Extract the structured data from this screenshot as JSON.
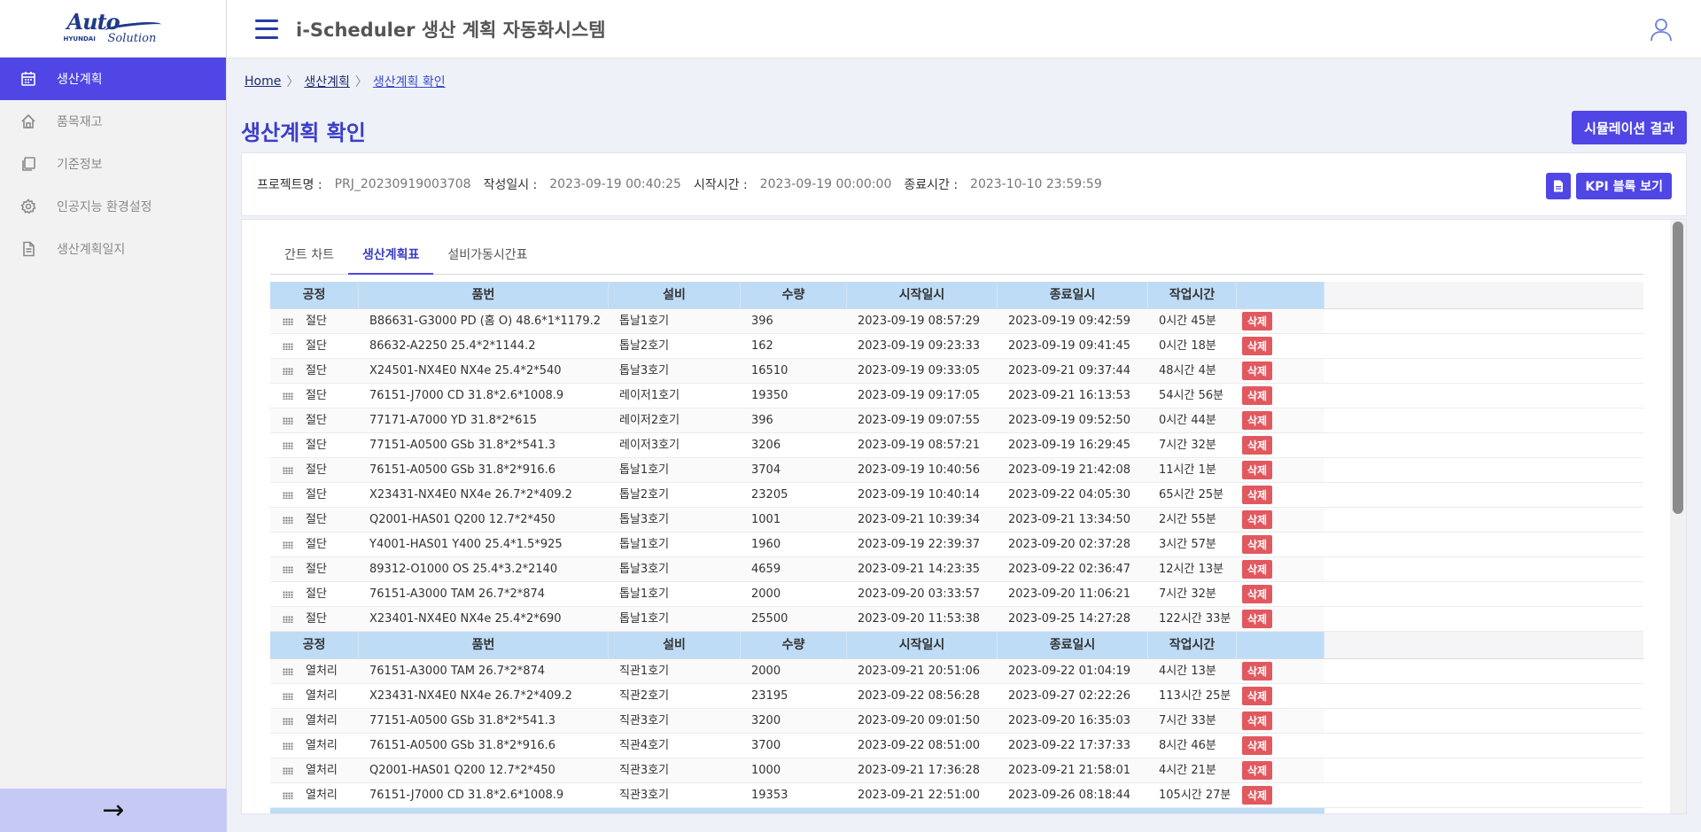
{
  "logo": {
    "auto": "Auto",
    "hyundai": "HYUNDAI",
    "solution": "Solution"
  },
  "app_title": "i-Scheduler 생산 계획 자동화시스템",
  "sidebar": {
    "items": [
      {
        "label": "생산계획",
        "icon": "calendar-icon"
      },
      {
        "label": "품목재고",
        "icon": "home-icon"
      },
      {
        "label": "기준정보",
        "icon": "copy-icon"
      },
      {
        "label": "인공지능 환경설정",
        "icon": "gear-icon"
      },
      {
        "label": "생산계획일지",
        "icon": "document-icon"
      }
    ],
    "toggle": "→"
  },
  "breadcrumb": {
    "home": "Home",
    "level1": "생산계획",
    "current": "생산계획 확인",
    "sep": "〉"
  },
  "page_title": "생산계획 확인",
  "simulation_button": "시뮬레이션 결과",
  "info": {
    "project_label": "프로젝트명 :",
    "project_value": "PRJ_20230919003708",
    "created_label": "작성일시 :",
    "created_value": "2023-09-19 00:40:25",
    "start_label": "시작시간 :",
    "start_value": "2023-09-19 00:00:00",
    "end_label": "종료시간 :",
    "end_value": "2023-10-10 23:59:59",
    "kpi_button": "KPI 블록 보기"
  },
  "tabs": [
    "간트 차트",
    "생산계획표",
    "설비가동시간표"
  ],
  "columns": [
    "공정",
    "품번",
    "설비",
    "수량",
    "시작일시",
    "종료일시",
    "작업시간"
  ],
  "delete_label": "삭제",
  "groups": [
    {
      "rows": [
        [
          "절단",
          "B86631-G3000 PD (홈 O) 48.6*1*1179.2",
          "톱날1호기",
          "396",
          "2023-09-19 08:57:29",
          "2023-09-19 09:42:59",
          "0시간 45분"
        ],
        [
          "절단",
          "86632-A2250 25.4*2*1144.2",
          "톱날2호기",
          "162",
          "2023-09-19 09:23:33",
          "2023-09-19 09:41:45",
          "0시간 18분"
        ],
        [
          "절단",
          "X24501-NX4E0 NX4e 25.4*2*540",
          "톱날3호기",
          "16510",
          "2023-09-19 09:33:05",
          "2023-09-21 09:37:44",
          "48시간 4분"
        ],
        [
          "절단",
          "76151-J7000 CD 31.8*2.6*1008.9",
          "레이저1호기",
          "19350",
          "2023-09-19 09:17:05",
          "2023-09-21 16:13:53",
          "54시간 56분"
        ],
        [
          "절단",
          "77171-A7000 YD 31.8*2*615",
          "레이저2호기",
          "396",
          "2023-09-19 09:07:55",
          "2023-09-19 09:52:50",
          "0시간 44분"
        ],
        [
          "절단",
          "77151-A0500 GSb 31.8*2*541.3",
          "레이저3호기",
          "3206",
          "2023-09-19 08:57:21",
          "2023-09-19 16:29:45",
          "7시간 32분"
        ],
        [
          "절단",
          "76151-A0500 GSb 31.8*2*916.6",
          "톱날1호기",
          "3704",
          "2023-09-19 10:40:56",
          "2023-09-19 21:42:08",
          "11시간 1분"
        ],
        [
          "절단",
          "X23431-NX4E0 NX4e 26.7*2*409.2",
          "톱날2호기",
          "23205",
          "2023-09-19 10:40:14",
          "2023-09-22 04:05:30",
          "65시간 25분"
        ],
        [
          "절단",
          "Q2001-HAS01 Q200 12.7*2*450",
          "톱날3호기",
          "1001",
          "2023-09-21 10:39:34",
          "2023-09-21 13:34:50",
          "2시간 55분"
        ],
        [
          "절단",
          "Y4001-HAS01 Y400 25.4*1.5*925",
          "톱날1호기",
          "1960",
          "2023-09-19 22:39:37",
          "2023-09-20 02:37:28",
          "3시간 57분"
        ],
        [
          "절단",
          "89312-O1000 OS 25.4*3.2*2140",
          "톱날3호기",
          "4659",
          "2023-09-21 14:23:35",
          "2023-09-22 02:36:47",
          "12시간 13분"
        ],
        [
          "절단",
          "76151-A3000 TAM 26.7*2*874",
          "톱날1호기",
          "2000",
          "2023-09-20 03:33:57",
          "2023-09-20 11:06:21",
          "7시간 32분"
        ],
        [
          "절단",
          "X23401-NX4E0 NX4e 25.4*2*690",
          "톱날1호기",
          "25500",
          "2023-09-20 11:53:38",
          "2023-09-25 14:27:28",
          "122시간 33분"
        ]
      ]
    },
    {
      "rows": [
        [
          "열처리",
          "76151-A3000 TAM 26.7*2*874",
          "직관1호기",
          "2000",
          "2023-09-21 20:51:06",
          "2023-09-22 01:04:19",
          "4시간 13분"
        ],
        [
          "열처리",
          "X23431-NX4E0 NX4e 26.7*2*409.2",
          "직관2호기",
          "23195",
          "2023-09-22 08:56:28",
          "2023-09-27 02:22:26",
          "113시간 25분"
        ],
        [
          "열처리",
          "77151-A0500 GSb 31.8*2*541.3",
          "직관3호기",
          "3200",
          "2023-09-20 09:01:50",
          "2023-09-20 16:35:03",
          "7시간 33분"
        ],
        [
          "열처리",
          "76151-A0500 GSb 31.8*2*916.6",
          "직관4호기",
          "3700",
          "2023-09-22 08:51:00",
          "2023-09-22 17:37:33",
          "8시간 46분"
        ],
        [
          "열처리",
          "Q2001-HAS01 Q200 12.7*2*450",
          "직관3호기",
          "1000",
          "2023-09-21 17:36:28",
          "2023-09-21 21:58:01",
          "4시간 21분"
        ],
        [
          "열처리",
          "76151-J7000 CD 31.8*2.6*1008.9",
          "직관3호기",
          "19353",
          "2023-09-21 22:51:00",
          "2023-09-26 08:18:44",
          "105시간 27분"
        ]
      ]
    }
  ],
  "colors": {
    "accent": "#4f46e5",
    "header_bg": "#bfdcf6",
    "delete": "#e2585f",
    "sidebar_toggle": "#c7c9f5"
  }
}
